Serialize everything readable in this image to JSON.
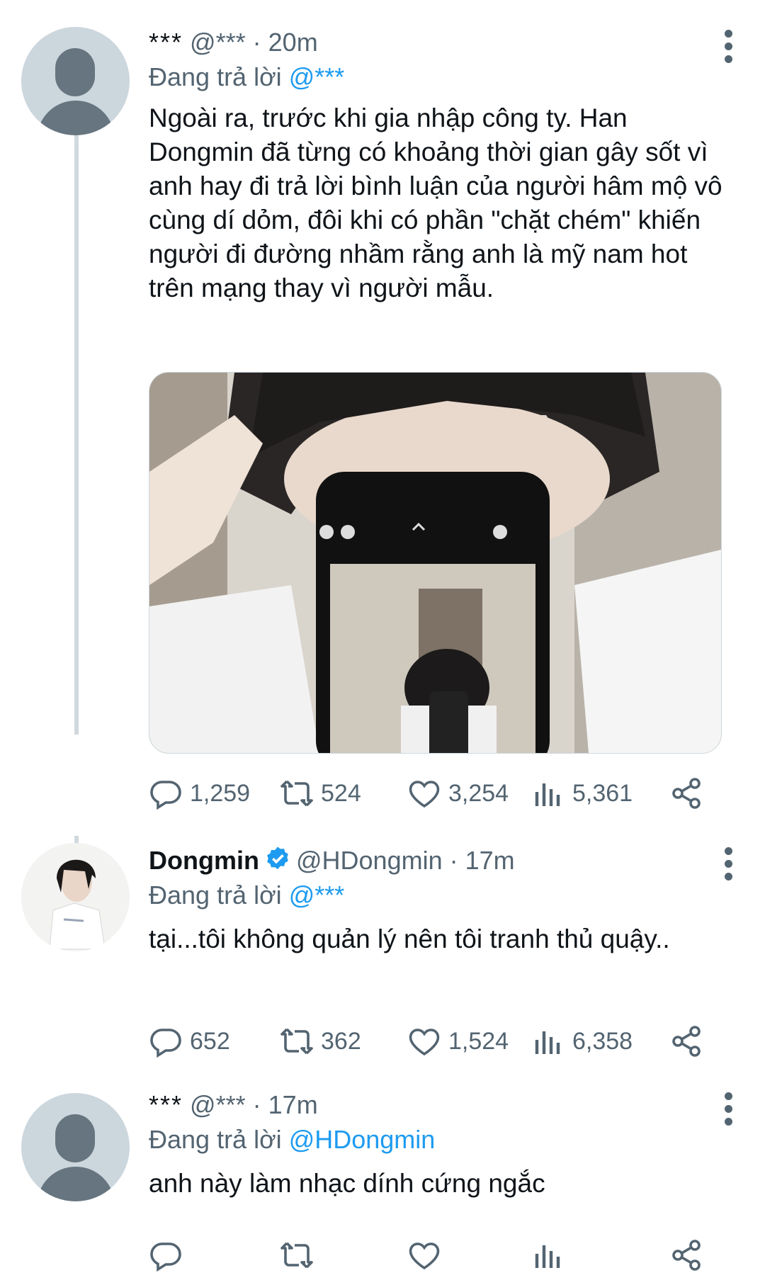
{
  "tweets": [
    {
      "name": "***",
      "handle": "@***",
      "separator": "·",
      "time": "20m",
      "replying_prefix": "Đang trả lời",
      "replying_to": "@***",
      "text": "Ngoài ra, trước khi gia nhập công ty. Han Dongmin đã từng có khoảng thời gian gây sốt vì anh hay đi trả lời bình luận của người hâm mộ vô cùng dí dỏm, đôi khi có phần \"chặt chém\" khiến người đi đường nhầm rằng anh là mỹ nam hot trên mạng thay vì người mẫu.",
      "replies": "1,259",
      "retweets": "524",
      "likes": "3,254",
      "views": "5,361"
    },
    {
      "name": "Dongmin",
      "handle": "@HDongmin",
      "separator": "·",
      "time": "17m",
      "replying_prefix": "Đang trả lời",
      "replying_to": "@***",
      "text": "tại...tôi không quản lý nên tôi tranh thủ quậy..",
      "replies": "652",
      "retweets": "362",
      "likes": "1,524",
      "views": "6,358"
    },
    {
      "name": "***",
      "handle": "@***",
      "separator": "·",
      "time": "17m",
      "replying_prefix": "Đang trả lời",
      "replying_to": "@HDongmin",
      "text": "anh này làm nhạc dính cứng ngắc",
      "replies": "",
      "retweets": "",
      "likes": "",
      "views": ""
    }
  ],
  "icons": {
    "reply": "reply-icon",
    "retweet": "retweet-icon",
    "like": "heart-icon",
    "views": "views-icon",
    "share": "share-icon",
    "more": "more-vertical-icon",
    "verified": "verified-badge-icon"
  },
  "colors": {
    "link": "#1d9bf0",
    "secondary_text": "#536471",
    "thread_line": "#cfd9de",
    "default_avatar_bg": "#ccd6dd"
  }
}
